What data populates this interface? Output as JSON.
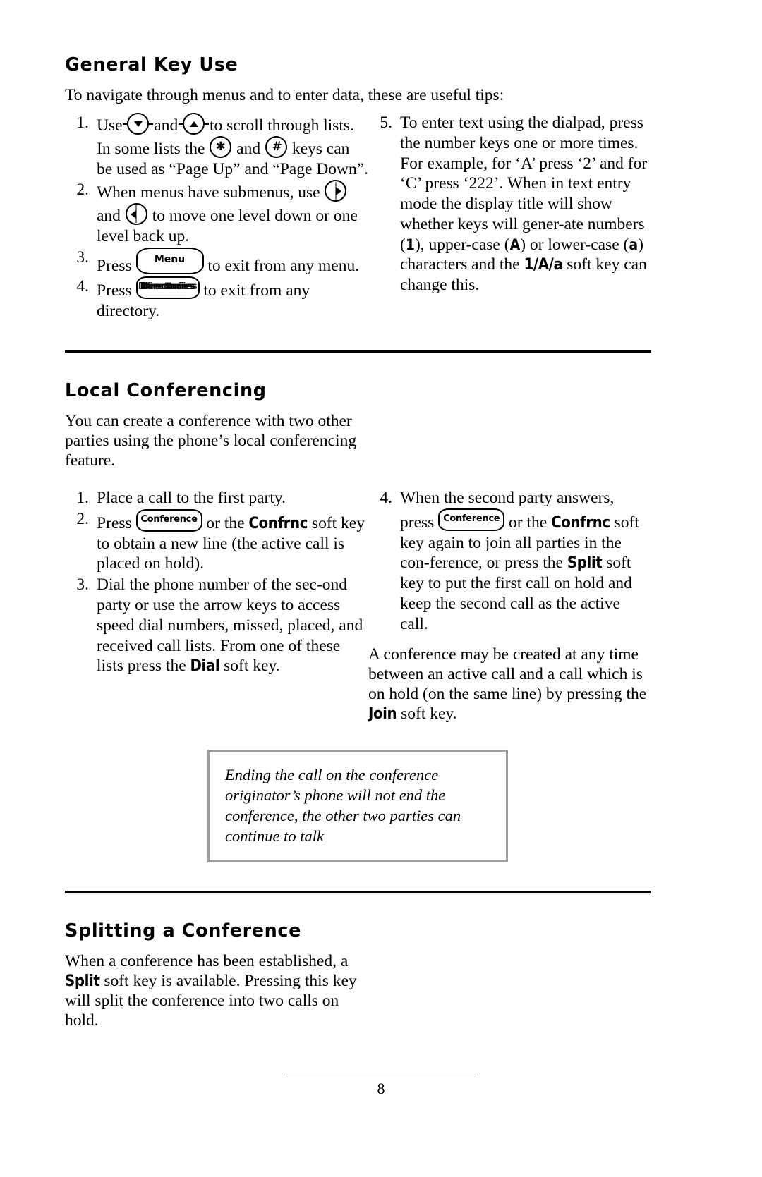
{
  "document": {
    "page_number": "8"
  },
  "sections": [
    {
      "id": "general-key-use",
      "heading": "General Key Use",
      "intro": "To navigate through menus and to enter data, these are useful tips:",
      "left_steps": [
        {
          "num": "1.",
          "parts": [
            {
              "t": "text",
              "v": "Use "
            },
            {
              "t": "key",
              "v": "scroll-down-arrow-key"
            },
            {
              "t": "text",
              "v": " and "
            },
            {
              "t": "key",
              "v": "scroll-up-arrow-key"
            },
            {
              "t": "text",
              "v": " to scroll through lists.  In some lists the "
            },
            {
              "t": "key",
              "v": "star-key"
            },
            {
              "t": "text",
              "v": " and "
            },
            {
              "t": "key",
              "v": "pound-key"
            },
            {
              "t": "text",
              "v": " keys can be used as “Page Up” and “Page Down”."
            }
          ],
          "plain": "Use (down) and (up) to scroll through lists.  In some lists the (*) and (#) keys can be used as “Page Up” and “Page Down”."
        },
        {
          "num": "2.",
          "plain": "When menus have submenus, use (right) and (left) to move one level down or one level back up."
        },
        {
          "num": "3.",
          "plain": "Press [Menu] to exit from any menu."
        },
        {
          "num": "4.",
          "plain": "Press [Directories] to exit from any directory."
        }
      ],
      "right_steps": [
        {
          "num": "5.",
          "plain": "To enter text using the dialpad, press the number keys one or more times.  For example, for ‘A’ press ‘2’ and for ‘C’ press ‘222’.  When in text entry mode the display title will show whether keys will generate numbers (1), upper-case (A) or lower-case (a) characters and the 1/A/a soft key can change this."
        }
      ],
      "step1": {
        "a": "Use",
        "b": "and",
        "c": "to scroll through lists.  In some lists the",
        "d": "and",
        "e": "keys can be used as “Page Up” and “Page Down”."
      },
      "step2": {
        "a": "When menus have submenus, use",
        "b": "and",
        "c": "to move one level down or one level back up."
      },
      "step3": {
        "a": "Press",
        "key_label": "Menu",
        "b": "to exit from any menu."
      },
      "step4": {
        "a": "Press",
        "key_label": "Directories",
        "b": "to exit from any directory."
      },
      "step5": {
        "a": "To enter text using the dialpad, press the number keys one or more times.  For example, for ‘A’ press ‘2’ and for ‘C’ press ‘222’.  When in text entry mode the display title will show whether keys will gener-ate numbers (",
        "lcd1": "1",
        "b": "), upper-case (",
        "lcdA": "A",
        "c": ") or lower-case (",
        "lcda": "a",
        "d": ") characters and the",
        "softkey": "1/A/a",
        "e": "soft key can change this."
      }
    },
    {
      "id": "local-conferencing",
      "heading": "Local Conferencing",
      "intro": "You can create a conference with two other parties using the phone’s local conferencing feature.",
      "step1": {
        "num": "1.",
        "text": "Place a call to the first party."
      },
      "step2": {
        "num": "2.",
        "a": "Press",
        "key_label": "Conference",
        "b": "or the",
        "softkey": "Confrnc",
        "c": "soft key to obtain a new line (the active call is placed on hold)."
      },
      "step3": {
        "num": "3.",
        "a": "Dial the phone number of the sec-ond party or use the arrow keys to access speed dial numbers, missed, placed, and received call lists.  From one of these lists press the",
        "softkey": "Dial",
        "b": "soft key."
      },
      "step4": {
        "num": "4.",
        "a": "When the second party answers, press",
        "key_label": "Conference",
        "b": "or the",
        "softkey1": "Confrnc",
        "c": "soft key again to join all parties in the con-ference, or press the",
        "softkey2": "Split",
        "d": "soft key to put the first call on hold and keep the second call as the active call."
      },
      "closing": {
        "a": "A conference may be created at any time between an active call and a call which is on hold (on the same line) by pressing the",
        "softkey": "Join",
        "b": "soft key."
      },
      "note": "Ending the call on the conference originator’s phone will not end the conference, the other two parties can continue to talk"
    },
    {
      "id": "splitting-a-conference",
      "heading": "Splitting a Conference",
      "body": {
        "a": "When a conference has been established, a",
        "softkey": "Split",
        "b": "soft key is available.  Pressing this key will split the conference into two calls on hold."
      }
    }
  ],
  "icons": {
    "scroll_down": "scroll-down-arrow-key-icon",
    "scroll_up": "scroll-up-arrow-key-icon",
    "star": "star-key-icon",
    "pound": "pound-key-icon",
    "nav_right": "right-arrow-key-icon",
    "nav_left": "left-arrow-key-icon"
  },
  "colors": {
    "text": "#000000",
    "background": "#ffffff",
    "rule": "#000000",
    "note_border": "#9d9d9d"
  }
}
